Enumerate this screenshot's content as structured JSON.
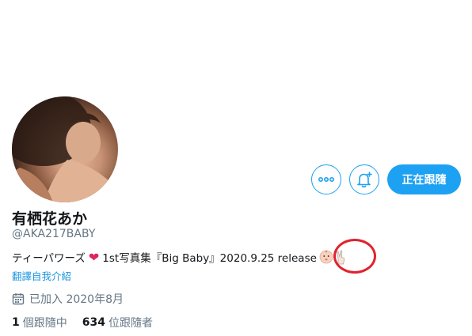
{
  "profile": {
    "display_name": "有栖花あか",
    "handle": "@AKA217BABY",
    "bio": {
      "before_heart": "ティーパワーズ",
      "heart": "❤",
      "after_heart": "1st写真集『Big Baby』2020.9.25 release",
      "emoji_icons": [
        "baby-face-icon",
        "victory-hand-icon"
      ]
    },
    "translate_label": "翻譯自我介紹",
    "joined": "已加入 2020年8月",
    "following_count": "1",
    "following_label": "個跟隨中",
    "followers_count": "634",
    "followers_label": "位跟隨者"
  },
  "actions": {
    "more_icon": "more-horizontal-icon",
    "notify_icon": "bell-plus-icon",
    "follow_label": "正在跟隨"
  },
  "colors": {
    "accent": "#1da1f2",
    "link": "#1b95e0",
    "secondary_text": "#657786",
    "heart": "#e0245e",
    "annotation": "#e0232f"
  }
}
